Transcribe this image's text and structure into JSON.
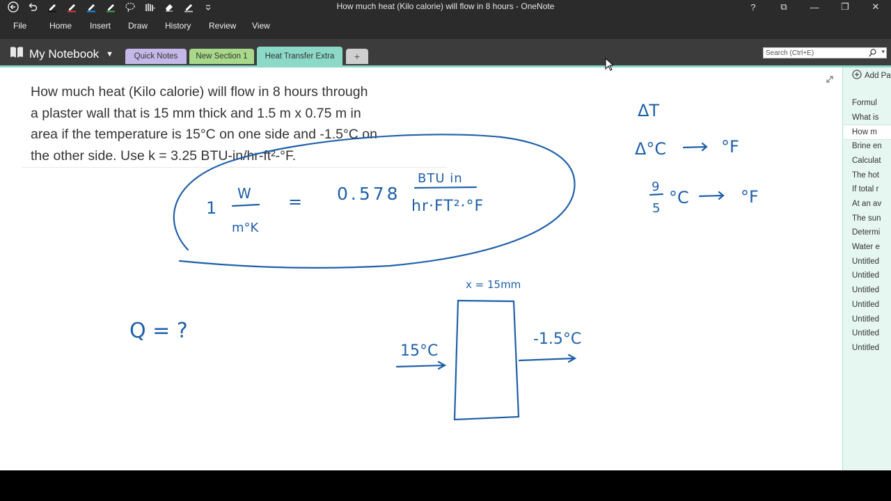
{
  "window": {
    "title": "How much heat (Kilo calorie) will flow in 8 hours  - OneNote",
    "controls": [
      "?",
      "⧉",
      "—",
      "❐",
      "✕"
    ]
  },
  "ribbon": {
    "tabs": [
      "File",
      "Home",
      "Insert",
      "Draw",
      "History",
      "Review",
      "View"
    ]
  },
  "notebook": {
    "name": "My Notebook"
  },
  "sections": [
    {
      "label": "Quick Notes",
      "color": "#c3b8e8"
    },
    {
      "label": "New Section 1",
      "color": "#a8d88a"
    },
    {
      "label": "Heat Transfer Extra",
      "color": "#8dd9c8"
    },
    {
      "label": "+",
      "color": "#cfcfcf"
    }
  ],
  "search": {
    "placeholder": "Search (Ctrl+E)"
  },
  "pages": {
    "add_label": "Add Pa",
    "items": [
      "Formul",
      "What is",
      "How m",
      "Brine en",
      "Calculat",
      "The hot",
      "If total r",
      "At an av",
      "The sun",
      "Determi",
      "Water e",
      "Untitled",
      "Untitled",
      "Untitled",
      "Untitled",
      "Untitled",
      "Untitled",
      "Untitled"
    ],
    "selected_index": 2
  },
  "question": {
    "lines": [
      "How much heat (Kilo calorie) will flow in 8 hours through",
      "a plaster wall that is 15 mm thick and 1.5 m x 0.75 m in",
      "area if the temperature is 15°C on one side and -1.5°C on",
      "the other side. Use k = 3.25 BTU-in/hr-ft²-°F."
    ]
  },
  "ink": {
    "ink_color": "#1f5fa8",
    "conv_one": "1",
    "conv_w": "W",
    "conv_mk": "m°K",
    "conv_eq": "=",
    "conv_value": "0.578",
    "conv_num": "BTU in",
    "conv_den": "hr·FT²·°F",
    "delta_t": "ΔT",
    "delta_c": "Δ°C",
    "deg_f1": "°F",
    "frac_num": "9",
    "frac_den": "5",
    "deg_c": "°C",
    "deg_f2": "°F",
    "q_label": "Q = ?",
    "x_label": "x = 15mm",
    "t_left": "15°C",
    "t_right": "-1.5°C"
  }
}
